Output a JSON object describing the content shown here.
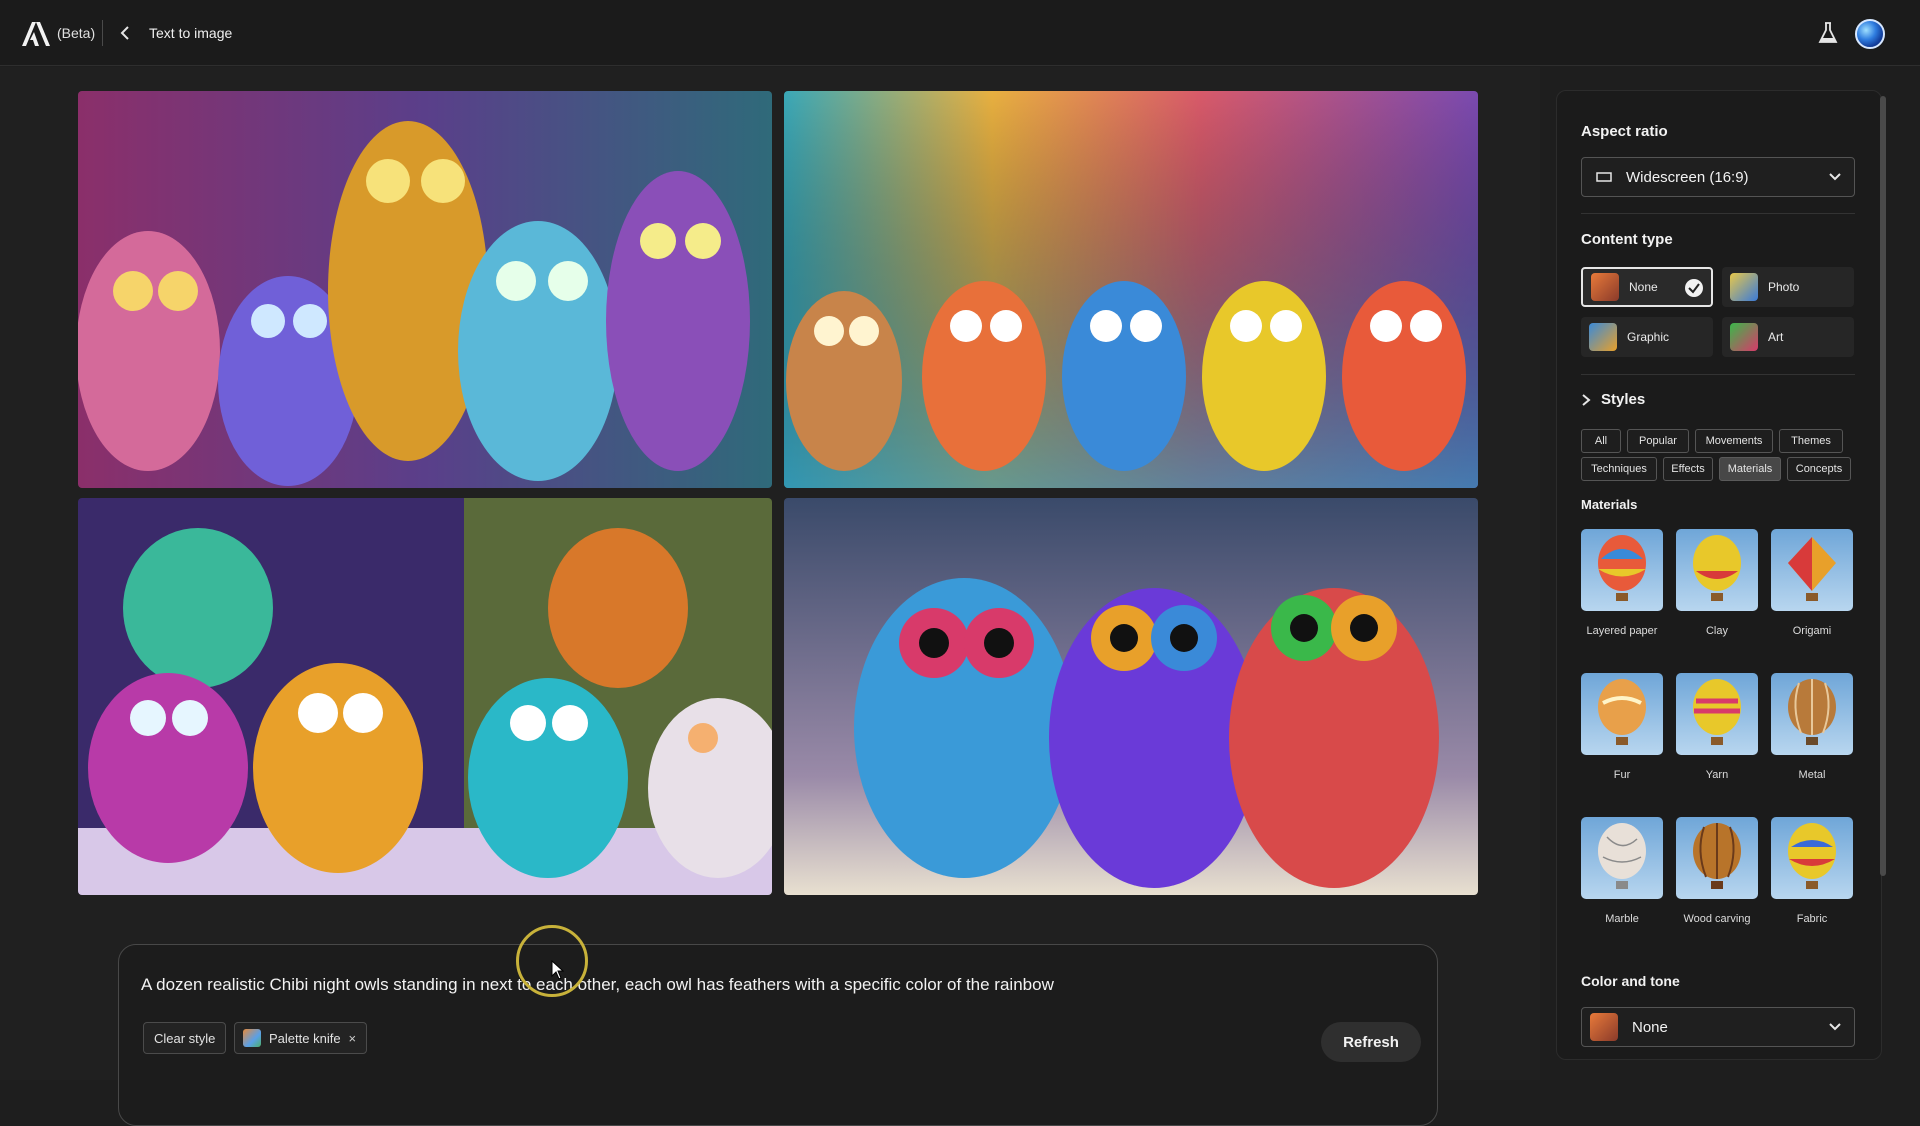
{
  "header": {
    "beta_label": "(Beta)",
    "breadcrumb": "Text to image"
  },
  "prompt": {
    "text": "A dozen realistic Chibi night owls standing in next to each other, each owl has feathers with a specific color of the rainbow",
    "clear_style_label": "Clear style",
    "chip_label": "Palette knife",
    "chip_remove": "×",
    "refresh_label": "Refresh"
  },
  "panel": {
    "aspect_ratio": {
      "heading": "Aspect ratio",
      "value": "Widescreen (16:9)"
    },
    "content_type": {
      "heading": "Content type",
      "options": [
        "None",
        "Photo",
        "Graphic",
        "Art"
      ],
      "selected": "None"
    },
    "styles": {
      "heading": "Styles",
      "tabs": [
        "All",
        "Popular",
        "Movements",
        "Themes",
        "Techniques",
        "Effects",
        "Materials",
        "Concepts"
      ],
      "active_tab": "Materials"
    },
    "materials": {
      "heading": "Materials",
      "items": [
        "Layered paper",
        "Clay",
        "Origami",
        "Fur",
        "Yarn",
        "Metal",
        "Marble",
        "Wood carving",
        "Fabric"
      ]
    },
    "color_tone": {
      "heading": "Color and tone",
      "value": "None"
    }
  },
  "colors": {
    "background": "#1e1e1e",
    "panel": "#1b1b1b",
    "accent_cursor": "#c8b23a"
  }
}
